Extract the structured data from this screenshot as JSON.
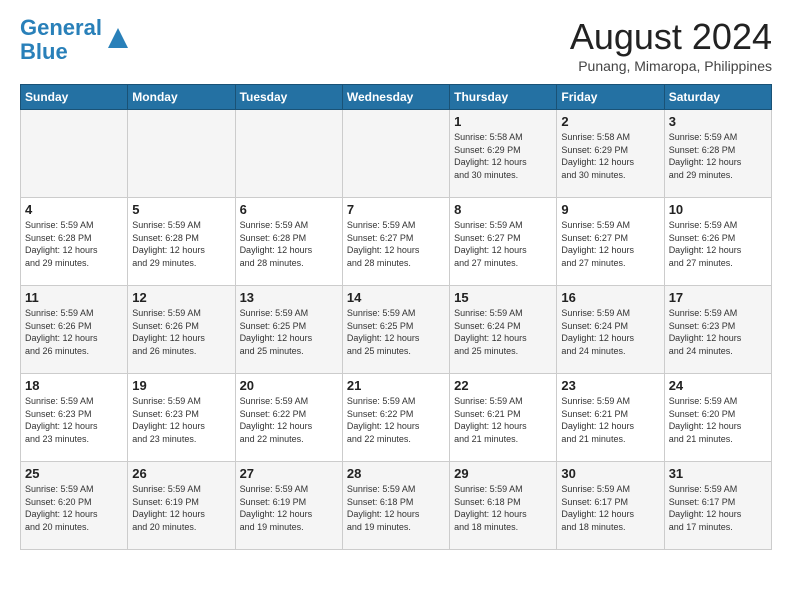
{
  "header": {
    "logo_line1": "General",
    "logo_line2": "Blue",
    "month_title": "August 2024",
    "subtitle": "Punang, Mimaropa, Philippines"
  },
  "weekdays": [
    "Sunday",
    "Monday",
    "Tuesday",
    "Wednesday",
    "Thursday",
    "Friday",
    "Saturday"
  ],
  "weeks": [
    [
      {
        "day": "",
        "info": ""
      },
      {
        "day": "",
        "info": ""
      },
      {
        "day": "",
        "info": ""
      },
      {
        "day": "",
        "info": ""
      },
      {
        "day": "1",
        "info": "Sunrise: 5:58 AM\nSunset: 6:29 PM\nDaylight: 12 hours\nand 30 minutes."
      },
      {
        "day": "2",
        "info": "Sunrise: 5:58 AM\nSunset: 6:29 PM\nDaylight: 12 hours\nand 30 minutes."
      },
      {
        "day": "3",
        "info": "Sunrise: 5:59 AM\nSunset: 6:28 PM\nDaylight: 12 hours\nand 29 minutes."
      }
    ],
    [
      {
        "day": "4",
        "info": "Sunrise: 5:59 AM\nSunset: 6:28 PM\nDaylight: 12 hours\nand 29 minutes."
      },
      {
        "day": "5",
        "info": "Sunrise: 5:59 AM\nSunset: 6:28 PM\nDaylight: 12 hours\nand 29 minutes."
      },
      {
        "day": "6",
        "info": "Sunrise: 5:59 AM\nSunset: 6:28 PM\nDaylight: 12 hours\nand 28 minutes."
      },
      {
        "day": "7",
        "info": "Sunrise: 5:59 AM\nSunset: 6:27 PM\nDaylight: 12 hours\nand 28 minutes."
      },
      {
        "day": "8",
        "info": "Sunrise: 5:59 AM\nSunset: 6:27 PM\nDaylight: 12 hours\nand 27 minutes."
      },
      {
        "day": "9",
        "info": "Sunrise: 5:59 AM\nSunset: 6:27 PM\nDaylight: 12 hours\nand 27 minutes."
      },
      {
        "day": "10",
        "info": "Sunrise: 5:59 AM\nSunset: 6:26 PM\nDaylight: 12 hours\nand 27 minutes."
      }
    ],
    [
      {
        "day": "11",
        "info": "Sunrise: 5:59 AM\nSunset: 6:26 PM\nDaylight: 12 hours\nand 26 minutes."
      },
      {
        "day": "12",
        "info": "Sunrise: 5:59 AM\nSunset: 6:26 PM\nDaylight: 12 hours\nand 26 minutes."
      },
      {
        "day": "13",
        "info": "Sunrise: 5:59 AM\nSunset: 6:25 PM\nDaylight: 12 hours\nand 25 minutes."
      },
      {
        "day": "14",
        "info": "Sunrise: 5:59 AM\nSunset: 6:25 PM\nDaylight: 12 hours\nand 25 minutes."
      },
      {
        "day": "15",
        "info": "Sunrise: 5:59 AM\nSunset: 6:24 PM\nDaylight: 12 hours\nand 25 minutes."
      },
      {
        "day": "16",
        "info": "Sunrise: 5:59 AM\nSunset: 6:24 PM\nDaylight: 12 hours\nand 24 minutes."
      },
      {
        "day": "17",
        "info": "Sunrise: 5:59 AM\nSunset: 6:23 PM\nDaylight: 12 hours\nand 24 minutes."
      }
    ],
    [
      {
        "day": "18",
        "info": "Sunrise: 5:59 AM\nSunset: 6:23 PM\nDaylight: 12 hours\nand 23 minutes."
      },
      {
        "day": "19",
        "info": "Sunrise: 5:59 AM\nSunset: 6:23 PM\nDaylight: 12 hours\nand 23 minutes."
      },
      {
        "day": "20",
        "info": "Sunrise: 5:59 AM\nSunset: 6:22 PM\nDaylight: 12 hours\nand 22 minutes."
      },
      {
        "day": "21",
        "info": "Sunrise: 5:59 AM\nSunset: 6:22 PM\nDaylight: 12 hours\nand 22 minutes."
      },
      {
        "day": "22",
        "info": "Sunrise: 5:59 AM\nSunset: 6:21 PM\nDaylight: 12 hours\nand 21 minutes."
      },
      {
        "day": "23",
        "info": "Sunrise: 5:59 AM\nSunset: 6:21 PM\nDaylight: 12 hours\nand 21 minutes."
      },
      {
        "day": "24",
        "info": "Sunrise: 5:59 AM\nSunset: 6:20 PM\nDaylight: 12 hours\nand 21 minutes."
      }
    ],
    [
      {
        "day": "25",
        "info": "Sunrise: 5:59 AM\nSunset: 6:20 PM\nDaylight: 12 hours\nand 20 minutes."
      },
      {
        "day": "26",
        "info": "Sunrise: 5:59 AM\nSunset: 6:19 PM\nDaylight: 12 hours\nand 20 minutes."
      },
      {
        "day": "27",
        "info": "Sunrise: 5:59 AM\nSunset: 6:19 PM\nDaylight: 12 hours\nand 19 minutes."
      },
      {
        "day": "28",
        "info": "Sunrise: 5:59 AM\nSunset: 6:18 PM\nDaylight: 12 hours\nand 19 minutes."
      },
      {
        "day": "29",
        "info": "Sunrise: 5:59 AM\nSunset: 6:18 PM\nDaylight: 12 hours\nand 18 minutes."
      },
      {
        "day": "30",
        "info": "Sunrise: 5:59 AM\nSunset: 6:17 PM\nDaylight: 12 hours\nand 18 minutes."
      },
      {
        "day": "31",
        "info": "Sunrise: 5:59 AM\nSunset: 6:17 PM\nDaylight: 12 hours\nand 17 minutes."
      }
    ]
  ]
}
